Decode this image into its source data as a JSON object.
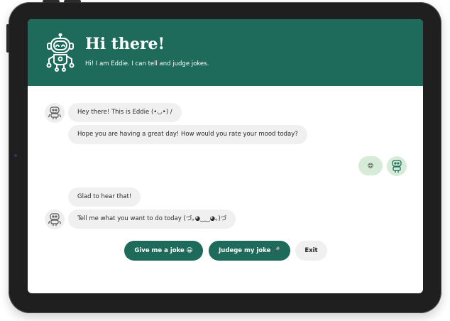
{
  "header": {
    "title": "Hi there!",
    "subtitle": "Hi! I am Eddie. I can tell and judge jokes.",
    "icon": "robot-icon",
    "background_color": "#1e6b5c"
  },
  "messages": [
    {
      "from": "bot",
      "text": "Hey there! This is Eddie (•◡•) /"
    },
    {
      "from": "bot",
      "text": "Hope you are having a great day! How would you rate your mood today?"
    },
    {
      "from": "user",
      "text": "😊"
    },
    {
      "from": "bot",
      "text": "Glad to hear that!"
    },
    {
      "from": "bot",
      "text": "Tell me what you want to do today (づ｡◕‿‿◕｡)づ"
    }
  ],
  "actions": {
    "joke_label": "Give me a joke 😀",
    "judge_label": "Judege my joke 🎤",
    "exit_label": "Exit"
  },
  "colors": {
    "accent": "#1e6b5c",
    "bot_bubble": "#f0f0f0",
    "user_bubble": "#d7ebd9"
  }
}
